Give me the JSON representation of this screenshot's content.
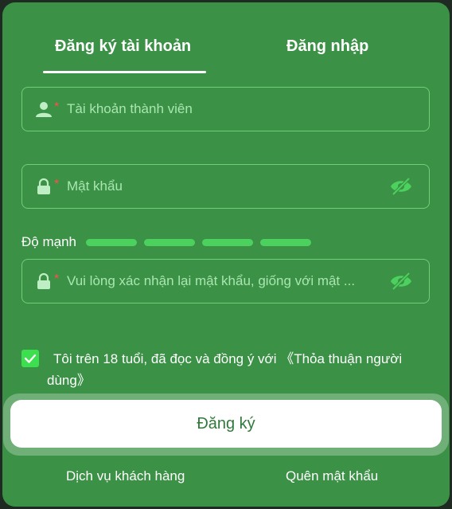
{
  "tabs": {
    "register": "Đăng ký tài khoản",
    "login": "Đăng nhập",
    "active": "register"
  },
  "account": {
    "placeholder": "Tài khoản thành viên",
    "required": "*",
    "icon": "user-icon"
  },
  "password": {
    "placeholder": "Mật khẩu",
    "required": "*",
    "icon": "lock-icon",
    "toggle_icon": "eye-off-icon"
  },
  "strength": {
    "label": "Độ mạnh",
    "segments": 4
  },
  "confirm": {
    "placeholder": "Vui lòng xác nhận lại mật khẩu, giống với mật ...",
    "required": "*",
    "icon": "lock-icon",
    "toggle_icon": "eye-off-icon"
  },
  "agreement": {
    "checked": true,
    "text": "Tôi trên 18 tuổi, đã đọc và đồng ý với 《Thỏa thuận người dùng》"
  },
  "submit": {
    "label": "Đăng ký"
  },
  "footer": {
    "support": "Dịch vụ khách hàng",
    "forgot": "Quên mật khẩu"
  },
  "colors": {
    "background": "#3b9145",
    "accent": "#4cd15e",
    "border": "#6fd07a",
    "required": "#ff4d4f",
    "checkbox": "#3ce04e"
  }
}
